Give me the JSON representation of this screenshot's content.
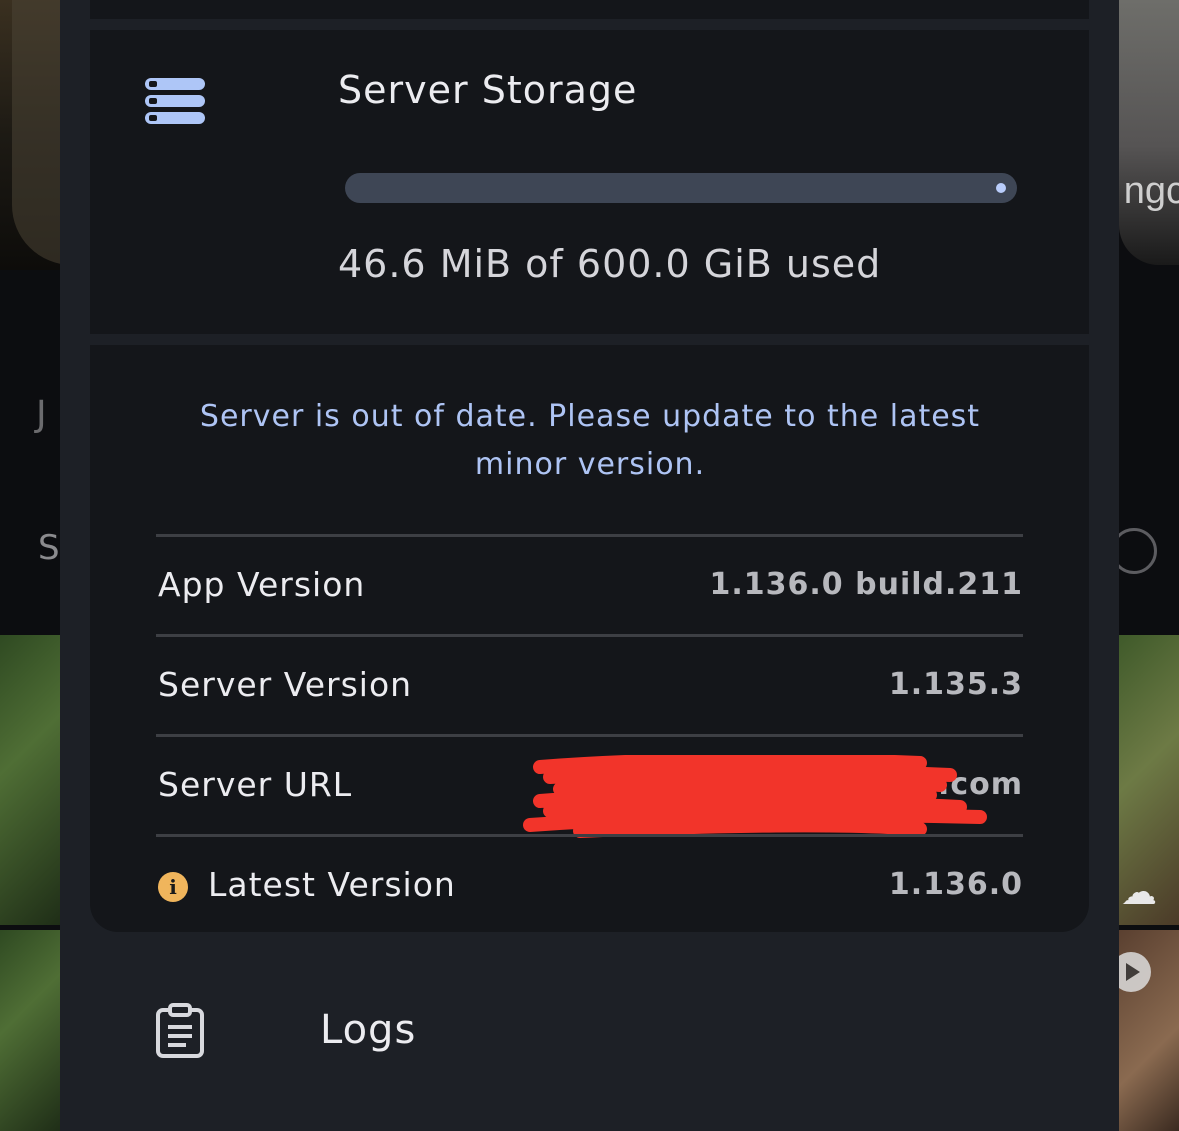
{
  "background": {
    "right_fragment_text": "ngc",
    "left_fragment_text": "S"
  },
  "storage": {
    "title": "Server Storage",
    "usage_text": "46.6 MiB of 600.0 GiB used",
    "used_fraction": 0.0001,
    "icon": "server-stack-icon"
  },
  "server_info": {
    "warning": "Server is out of date. Please update to the latest minor version.",
    "rows": [
      {
        "label": "App Version",
        "value": "1.136.0 build.211"
      },
      {
        "label": "Server Version",
        "value": "1.135.3"
      },
      {
        "label": "Server URL",
        "value": "https://….com",
        "redacted": true
      },
      {
        "label": "Latest Version",
        "value": "1.136.0",
        "icon": "info-icon"
      }
    ]
  },
  "logs": {
    "label": "Logs",
    "icon": "clipboard-icon"
  },
  "colors": {
    "accent": "#aec4f4",
    "warning_icon": "#f0b55c",
    "redaction": "#f2342a"
  }
}
